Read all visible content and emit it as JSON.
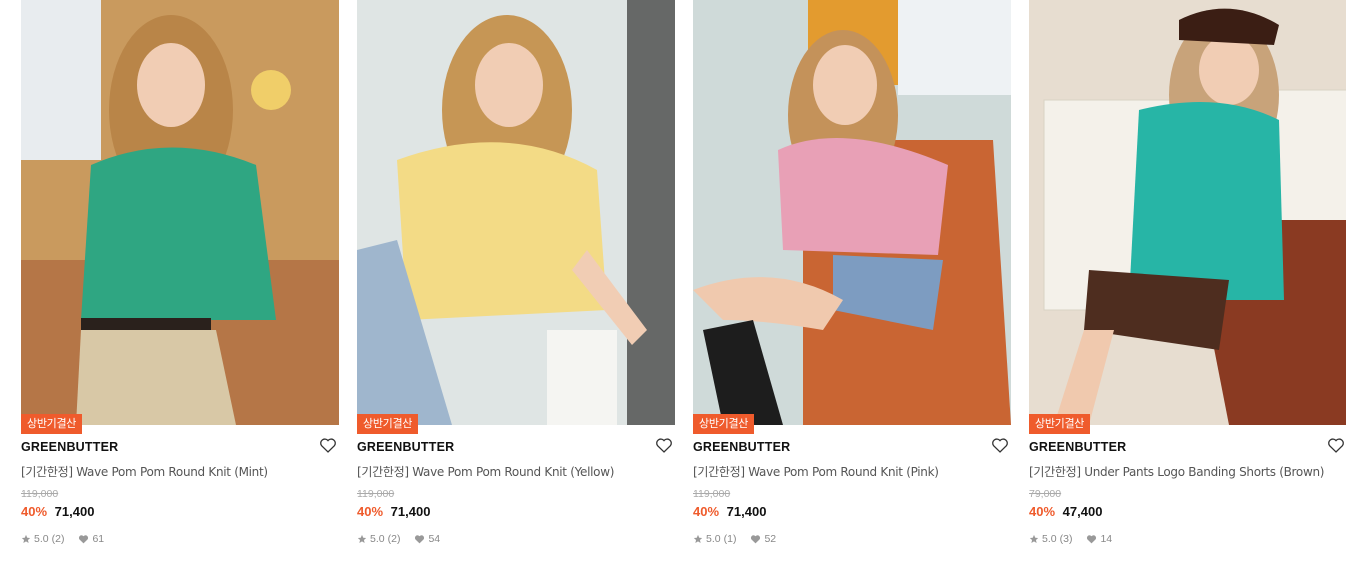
{
  "products": [
    {
      "badge": "상반기결산",
      "brand": "GREENBUTTER",
      "name": "[기간한정] Wave Pom Pom Round Knit (Mint)",
      "original_price": "119,000",
      "discount": "40%",
      "price": "71,400",
      "rating": "5.0",
      "review_count": "(2)",
      "likes": "61",
      "colors": {
        "top": "#2fa682",
        "bottom": "#d8c8a6",
        "bg": "#c99a5e",
        "hair": "#b98548"
      }
    },
    {
      "badge": "상반기결산",
      "brand": "GREENBUTTER",
      "name": "[기간한정] Wave Pom Pom Round Knit (Yellow)",
      "original_price": "119,000",
      "discount": "40%",
      "price": "71,400",
      "rating": "5.0",
      "review_count": "(2)",
      "likes": "54",
      "colors": {
        "top": "#f3db86",
        "bottom": "#9fb6cd",
        "bg": "#dfe5e4",
        "hair": "#c69655"
      }
    },
    {
      "badge": "상반기결산",
      "brand": "GREENBUTTER",
      "name": "[기간한정] Wave Pom Pom Round Knit (Pink)",
      "original_price": "119,000",
      "discount": "40%",
      "price": "71,400",
      "rating": "5.0",
      "review_count": "(1)",
      "likes": "52",
      "colors": {
        "top": "#e8a0b6",
        "bottom": "#7d9cc1",
        "bg": "#c96533",
        "hair": "#c4925a"
      }
    },
    {
      "badge": "상반기결산",
      "brand": "GREENBUTTER",
      "name": "[기간한정] Under Pants Logo Banding Shorts (Brown)",
      "original_price": "79,000",
      "discount": "40%",
      "price": "47,400",
      "rating": "5.0",
      "review_count": "(3)",
      "likes": "14",
      "colors": {
        "top": "#27b5a6",
        "bottom": "#4e2d1f",
        "bg": "#e7ddd0",
        "hair": "#c8a37a"
      }
    }
  ]
}
